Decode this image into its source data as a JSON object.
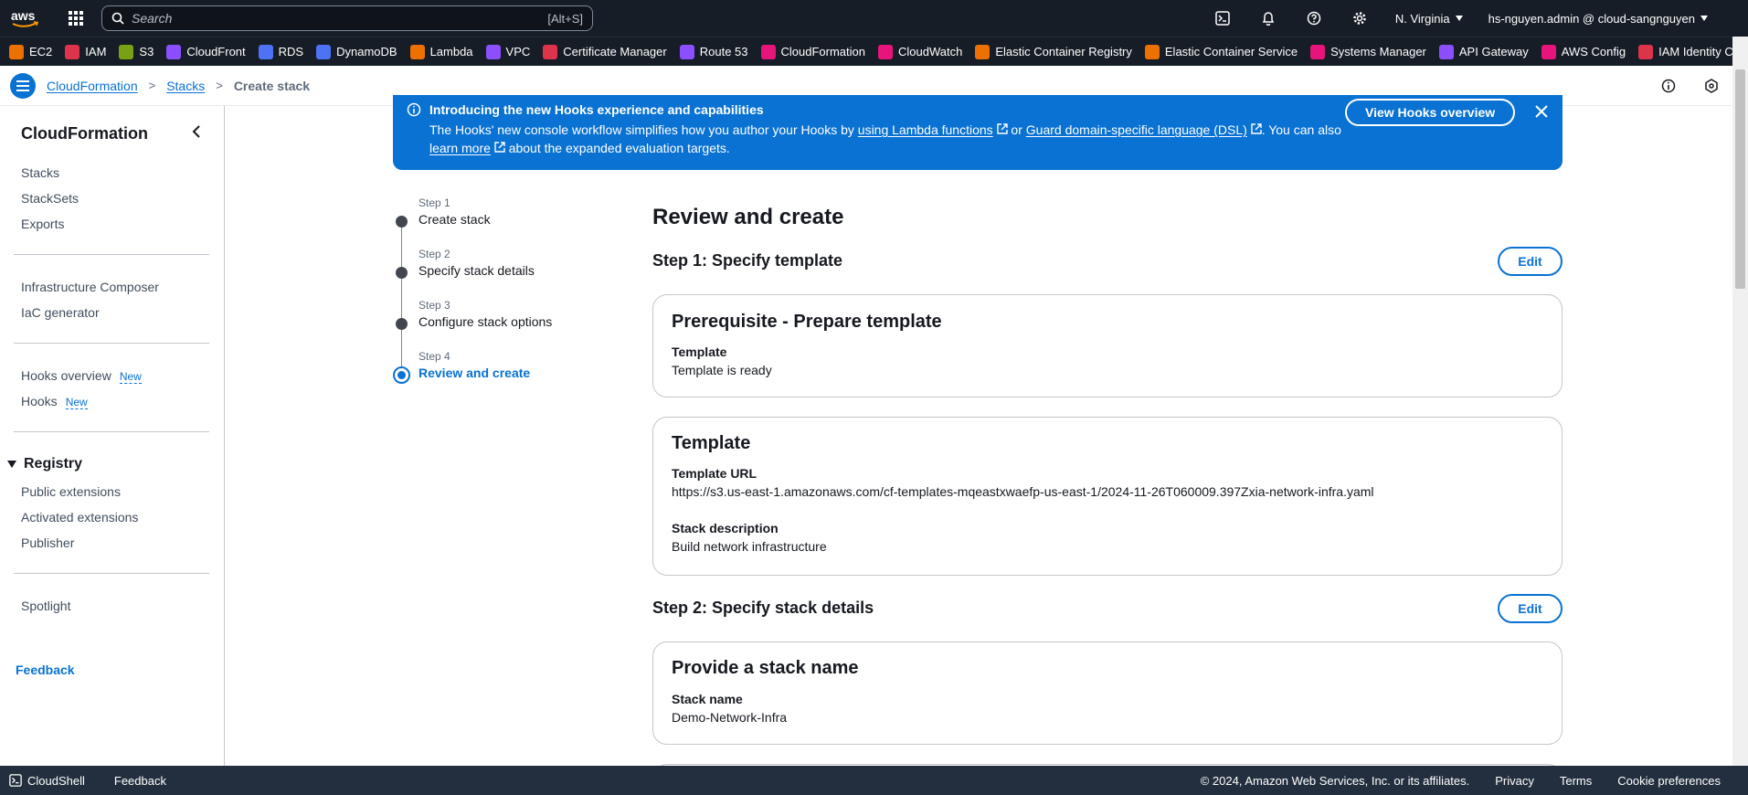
{
  "topnav": {
    "logo": "aws",
    "search_placeholder": "Search",
    "search_shortcut": "[Alt+S]",
    "region": "N. Virginia",
    "account": "hs-nguyen.admin @ cloud-sangnguyen",
    "icons": [
      "cloudshell-icon",
      "bell-icon",
      "help-icon",
      "gear-icon"
    ]
  },
  "favorites": [
    {
      "label": "EC2",
      "color": "#ed7100"
    },
    {
      "label": "IAM",
      "color": "#dd344c"
    },
    {
      "label": "S3",
      "color": "#7aa116"
    },
    {
      "label": "CloudFront",
      "color": "#8c4fff"
    },
    {
      "label": "RDS",
      "color": "#4d72f3"
    },
    {
      "label": "DynamoDB",
      "color": "#4d72f3"
    },
    {
      "label": "Lambda",
      "color": "#ed7100"
    },
    {
      "label": "VPC",
      "color": "#8c4fff"
    },
    {
      "label": "Certificate Manager",
      "color": "#dd344c"
    },
    {
      "label": "Route 53",
      "color": "#8c4fff"
    },
    {
      "label": "CloudFormation",
      "color": "#e7157b"
    },
    {
      "label": "CloudWatch",
      "color": "#e7157b"
    },
    {
      "label": "Elastic Container Registry",
      "color": "#ed7100"
    },
    {
      "label": "Elastic Container Service",
      "color": "#ed7100"
    },
    {
      "label": "Systems Manager",
      "color": "#e7157b"
    },
    {
      "label": "API Gateway",
      "color": "#8c4fff"
    },
    {
      "label": "AWS Config",
      "color": "#e7157b"
    },
    {
      "label": "IAM Identity C",
      "color": "#dd344c"
    }
  ],
  "breadcrumb": {
    "items": [
      "CloudFormation",
      "Stacks"
    ],
    "current": "Create stack"
  },
  "sidebar": {
    "title": "CloudFormation",
    "group1": [
      "Stacks",
      "StackSets",
      "Exports"
    ],
    "group2": [
      "Infrastructure Composer",
      "IaC generator"
    ],
    "group3": [
      {
        "label": "Hooks overview",
        "badge": "New"
      },
      {
        "label": "Hooks",
        "badge": "New"
      }
    ],
    "registry_title": "Registry",
    "registry_items": [
      "Public extensions",
      "Activated extensions",
      "Publisher"
    ],
    "spotlight": "Spotlight",
    "feedback": "Feedback"
  },
  "flash": {
    "title": "Introducing the new Hooks experience and capabilities",
    "body_1": "The Hooks' new console workflow simplifies how you author your Hooks by ",
    "link_1": "using Lambda functions",
    "body_2": " or ",
    "link_2": "Guard domain-specific language (DSL)",
    "body_3": ". You can also ",
    "link_3": "learn more",
    "body_4": " about the expanded evaluation targets.",
    "button": "View Hooks overview"
  },
  "wizard": {
    "steps": [
      {
        "num": "Step 1",
        "label": "Create stack"
      },
      {
        "num": "Step 2",
        "label": "Specify stack details"
      },
      {
        "num": "Step 3",
        "label": "Configure stack options"
      },
      {
        "num": "Step 4",
        "label": "Review and create"
      }
    ]
  },
  "main": {
    "title": "Review and create",
    "section1": {
      "heading": "Step 1: Specify template",
      "edit": "Edit",
      "card1": {
        "title": "Prerequisite - Prepare template",
        "key": "Template",
        "value": "Template is ready"
      },
      "card2": {
        "title": "Template",
        "url_key": "Template URL",
        "url_value": "https://s3.us-east-1.amazonaws.com/cf-templates-mqeastxwaefp-us-east-1/2024-11-26T060009.397Zxia-network-infra.yaml",
        "desc_key": "Stack description",
        "desc_value": "Build network infrastructure"
      }
    },
    "section2": {
      "heading": "Step 2: Specify stack details",
      "edit": "Edit",
      "card1": {
        "title": "Provide a stack name",
        "key": "Stack name",
        "value": "Demo-Network-Infra"
      }
    }
  },
  "footer": {
    "cloudshell": "CloudShell",
    "feedback": "Feedback",
    "copyright": "© 2024, Amazon Web Services, Inc. or its affiliates.",
    "privacy": "Privacy",
    "terms": "Terms",
    "cookies": "Cookie preferences"
  }
}
